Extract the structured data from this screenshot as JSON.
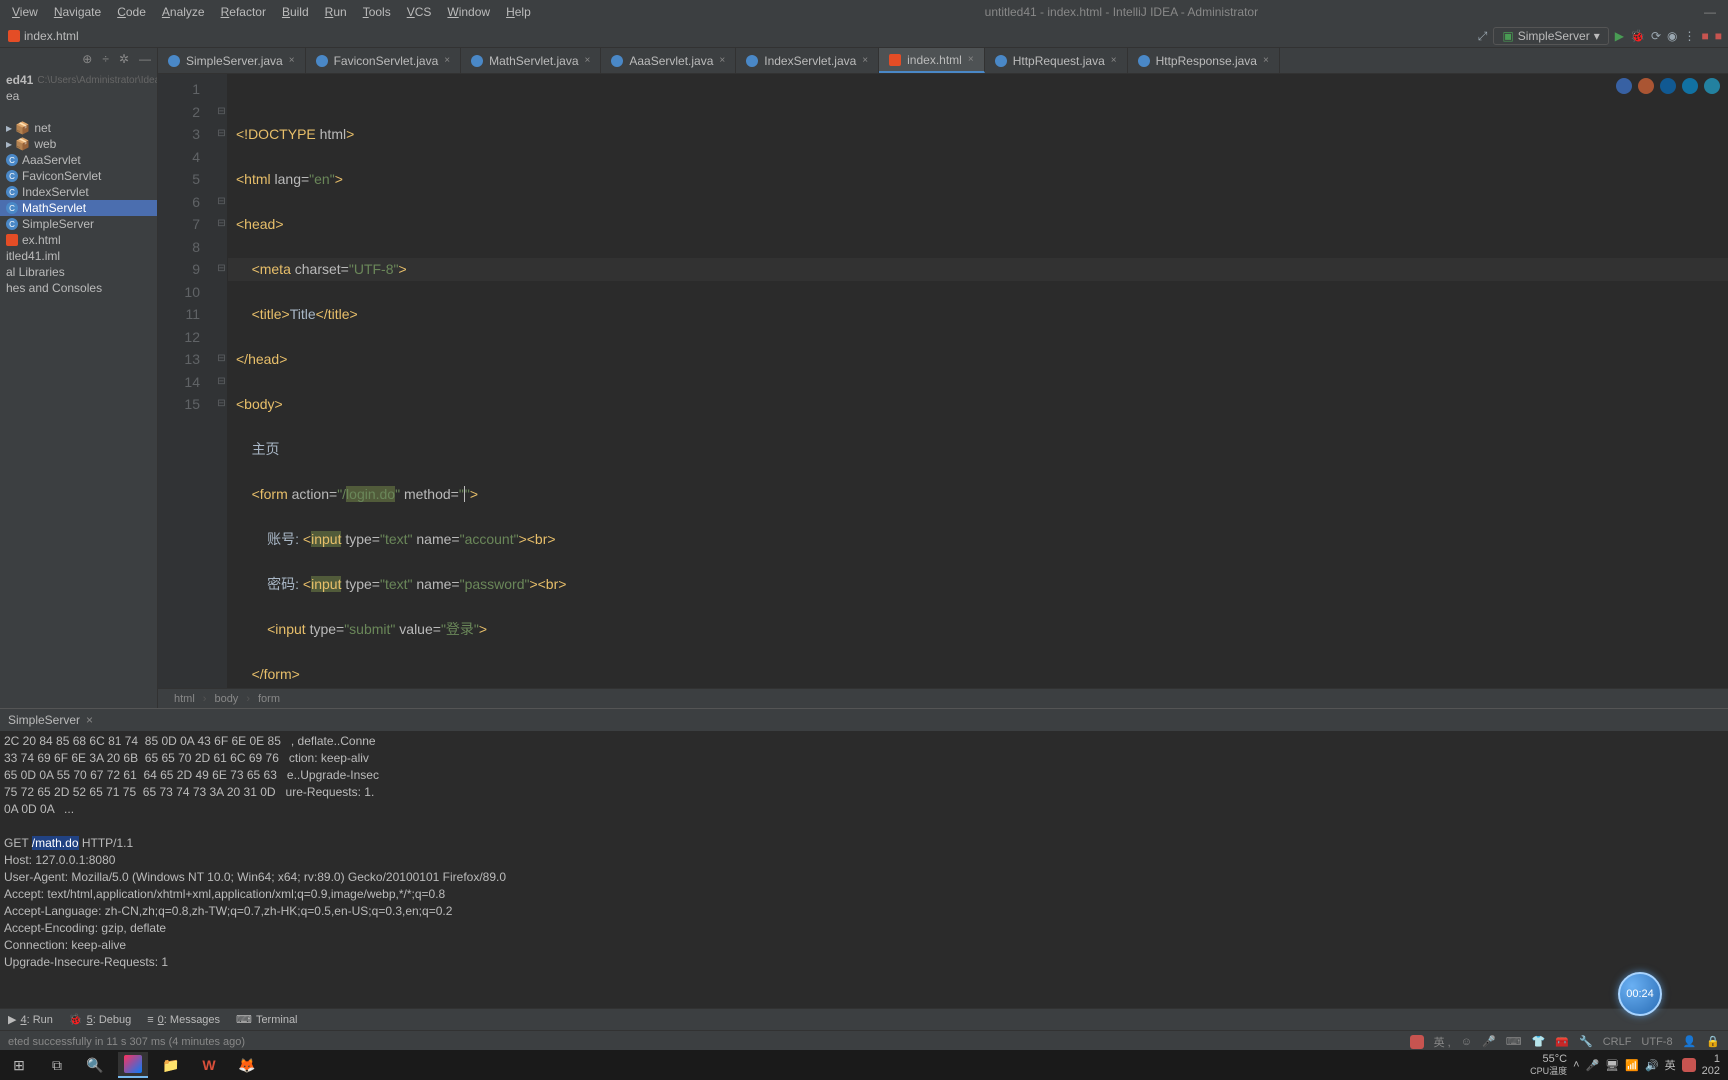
{
  "menubar": [
    "View",
    "Navigate",
    "Code",
    "Analyze",
    "Refactor",
    "Build",
    "Run",
    "Tools",
    "VCS",
    "Window",
    "Help"
  ],
  "window_title": "untitled41 - index.html - IntelliJ IDEA - Administrator",
  "filetab": "index.html",
  "run_config_label": "SimpleServer",
  "sidebar": {
    "path_hint": "C:\\Users\\Administrator\\Idea",
    "root": "ed41",
    "nodes": [
      {
        "label": "ea",
        "icon": ""
      },
      {
        "label": "",
        "icon": ""
      },
      {
        "label": "net",
        "icon": "pkg"
      },
      {
        "label": "web",
        "icon": "pkg"
      },
      {
        "label": "AaaServlet",
        "icon": "class"
      },
      {
        "label": "FaviconServlet",
        "icon": "class"
      },
      {
        "label": "IndexServlet",
        "icon": "class"
      },
      {
        "label": "MathServlet",
        "icon": "class",
        "selected": true
      },
      {
        "label": "SimpleServer",
        "icon": "class"
      },
      {
        "label": "ex.html",
        "icon": "html"
      },
      {
        "label": "itled41.iml",
        "icon": ""
      },
      {
        "label": "al Libraries",
        "icon": ""
      },
      {
        "label": "hes and Consoles",
        "icon": ""
      }
    ]
  },
  "editor_tabs": [
    {
      "label": "SimpleServer.java",
      "icon": "java"
    },
    {
      "label": "FaviconServlet.java",
      "icon": "java"
    },
    {
      "label": "MathServlet.java",
      "icon": "java"
    },
    {
      "label": "AaaServlet.java",
      "icon": "java"
    },
    {
      "label": "IndexServlet.java",
      "icon": "java"
    },
    {
      "label": "index.html",
      "icon": "html",
      "active": true
    },
    {
      "label": "HttpRequest.java",
      "icon": "java"
    },
    {
      "label": "HttpResponse.java",
      "icon": "java"
    }
  ],
  "code_lines": 15,
  "breadcrumb": [
    "html",
    "body",
    "form"
  ],
  "run_panel": {
    "title": "SimpleServer",
    "hex_lines": [
      "2C 20 84 85 68 6C 81 74  85 0D 0A 43 6F 6E 0E 85   , deflate..Conne",
      "33 74 69 6F 6E 3A 20 6B  65 65 70 2D 61 6C 69 76   ction: keep-aliv",
      "65 0D 0A 55 70 67 72 61  64 65 2D 49 6E 73 65 63   e..Upgrade-Insec",
      "75 72 65 2D 52 65 71 75  65 73 74 73 3A 20 31 0D   ure-Requests: 1.",
      "0A 0D 0A   ..."
    ],
    "http": {
      "method": "GET",
      "path": "/math.do",
      "proto": "HTTP/1.1",
      "lines": [
        "Host: 127.0.0.1:8080",
        "User-Agent: Mozilla/5.0 (Windows NT 10.0; Win64; x64; rv:89.0) Gecko/20100101 Firefox/89.0",
        "Accept: text/html,application/xhtml+xml,application/xml;q=0.9,image/webp,*/*;q=0.8",
        "Accept-Language: zh-CN,zh;q=0.8,zh-TW;q=0.7,zh-HK;q=0.5,en-US;q=0.3,en;q=0.2",
        "Accept-Encoding: gzip, deflate",
        "Connection: keep-alive",
        "Upgrade-Insecure-Requests: 1"
      ]
    }
  },
  "tool_tabs": [
    {
      "key": "4",
      "label": "Run",
      "icon": "▶"
    },
    {
      "key": "5",
      "label": "Debug",
      "icon": "🐞"
    },
    {
      "key": "0",
      "label": "Messages",
      "icon": "≡"
    },
    {
      "key": "",
      "label": "Terminal",
      "icon": "⌨"
    }
  ],
  "status_left": "eted successfully in 11 s 307 ms (4 minutes ago)",
  "status_right": {
    "crlf": "CRLF",
    "enc": "UTF-8",
    "lock": "🔒"
  },
  "timer": "00:24",
  "tray": {
    "temp": "55°C",
    "temp_label": "CPU温度",
    "ime": "英",
    "time": "1",
    "date": "202"
  }
}
